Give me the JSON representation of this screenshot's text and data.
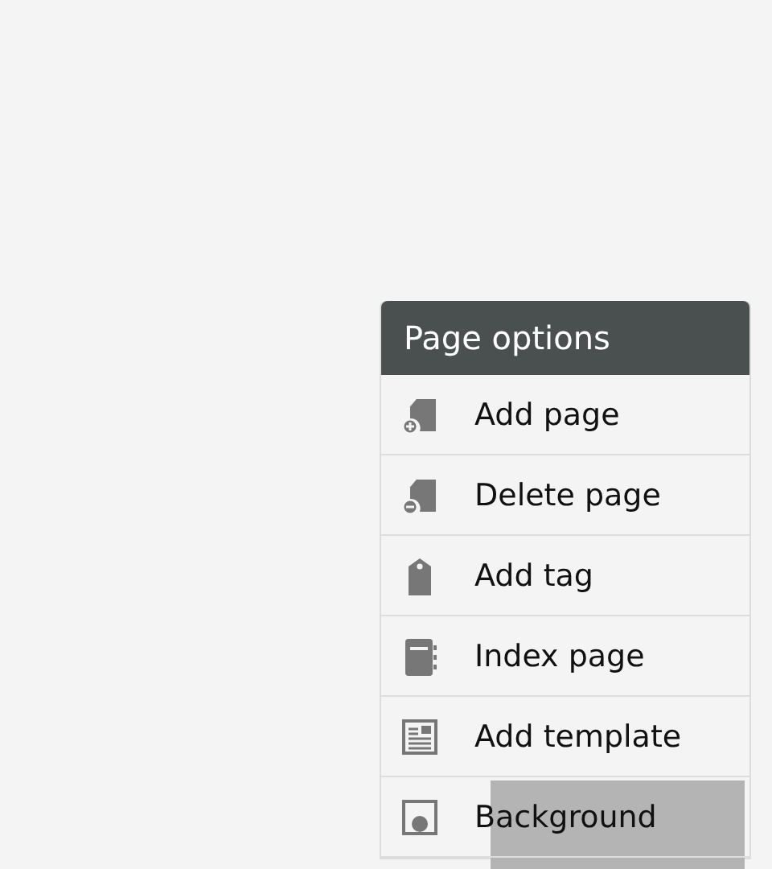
{
  "menu": {
    "title": "Page options",
    "items": [
      {
        "label": "Add page",
        "kind": "add-page"
      },
      {
        "label": "Delete page",
        "kind": "delete-page"
      },
      {
        "label": "Add tag",
        "kind": "tag"
      },
      {
        "label": "Index page",
        "kind": "index"
      },
      {
        "label": "Add template",
        "kind": "template"
      },
      {
        "label": "Background",
        "kind": "background"
      }
    ]
  }
}
